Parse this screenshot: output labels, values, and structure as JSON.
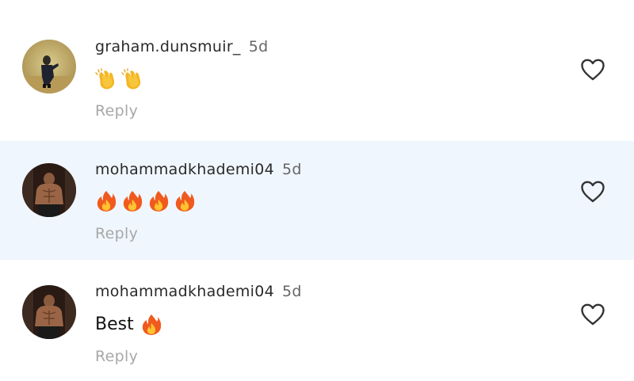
{
  "comments": [
    {
      "username": "graham.dunsmuir_",
      "time": "5d",
      "text": "",
      "emojis": [
        "clapping-hands",
        "clapping-hands"
      ],
      "reply_label": "Reply",
      "avatar_icon": "avatar-graham",
      "like_icon": "heart-outline-icon"
    },
    {
      "username": "mohammadkhademi04",
      "time": "5d",
      "text": "",
      "emojis": [
        "fire",
        "fire",
        "fire",
        "fire"
      ],
      "reply_label": "Reply",
      "avatar_icon": "avatar-mohammad",
      "like_icon": "heart-outline-icon"
    },
    {
      "username": "mohammadkhademi04",
      "time": "5d",
      "text": "Best",
      "emojis": [
        "fire"
      ],
      "reply_label": "Reply",
      "avatar_icon": "avatar-mohammad",
      "like_icon": "heart-outline-icon"
    }
  ],
  "colors": {
    "highlight_row": "#f0f6fd",
    "reply": "#a8a8a8",
    "time": "#666666",
    "username": "#2a2a2a"
  }
}
